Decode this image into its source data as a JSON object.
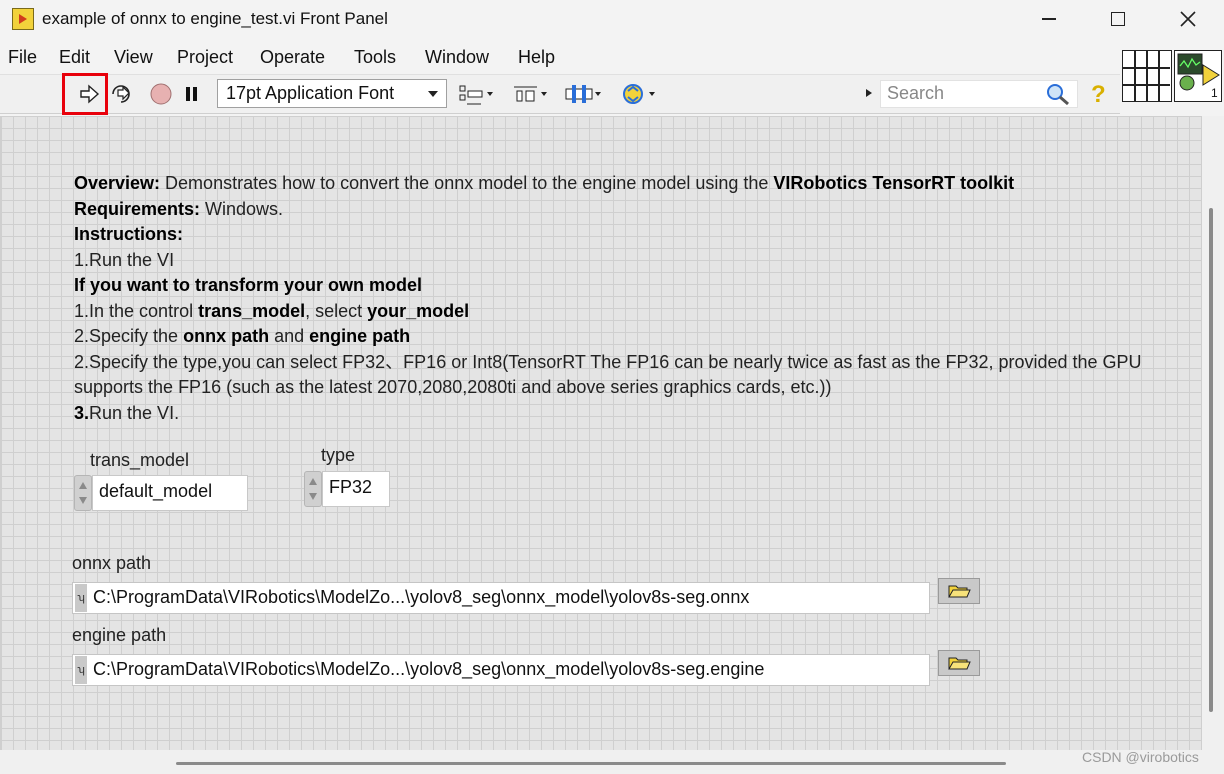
{
  "window": {
    "title": "example of onnx to engine_test.vi Front Panel"
  },
  "menu": [
    "File",
    "Edit",
    "View",
    "Project",
    "Operate",
    "Tools",
    "Window",
    "Help"
  ],
  "toolbar": {
    "font": "17pt Application Font",
    "search_placeholder": "Search",
    "help": "?"
  },
  "vi_icon": {
    "connector_count": "1"
  },
  "description": {
    "overview_label": "Overview:",
    "overview_text": " Demonstrates how to convert the onnx model to the engine model using the ",
    "overview_bold": "VIRobotics TensorRT toolkit",
    "requirements_label": "Requirements:",
    "requirements_text": " Windows.",
    "instructions_label": "Instructions:",
    "step_run": "1.Run the VI",
    "custom_heading": "If you want to transform your own model",
    "step1_a": "1.In the control ",
    "step1_b": "trans_model",
    "step1_c": ", select ",
    "step1_d": "your_model",
    "step2_a": "2.Specify the ",
    "step2_b": "onnx path",
    "step2_c": " and ",
    "step2_d": "engine path",
    "step3": "2.Specify the type,you can select FP32、FP16 or Int8(TensorRT The FP16 can be nearly twice as fast as the FP32, provided the GPU supports the FP16 (such as the latest 2070,2080,2080ti and above series graphics cards, etc.))",
    "step4_a": "3.",
    "step4_b": "Run the VI."
  },
  "controls": {
    "trans_model": {
      "label": "trans_model",
      "value": "default_model"
    },
    "type": {
      "label": "type",
      "value": "FP32"
    },
    "onnx_path": {
      "label": "onnx path",
      "value": "C:\\ProgramData\\VIRobotics\\ModelZo...\\yolov8_seg\\onnx_model\\yolov8s-seg.onnx"
    },
    "engine_path": {
      "label": "engine path",
      "value": "C:\\ProgramData\\VIRobotics\\ModelZo...\\yolov8_seg\\onnx_model\\yolov8s-seg.engine"
    }
  },
  "watermark": "CSDN @virobotics"
}
